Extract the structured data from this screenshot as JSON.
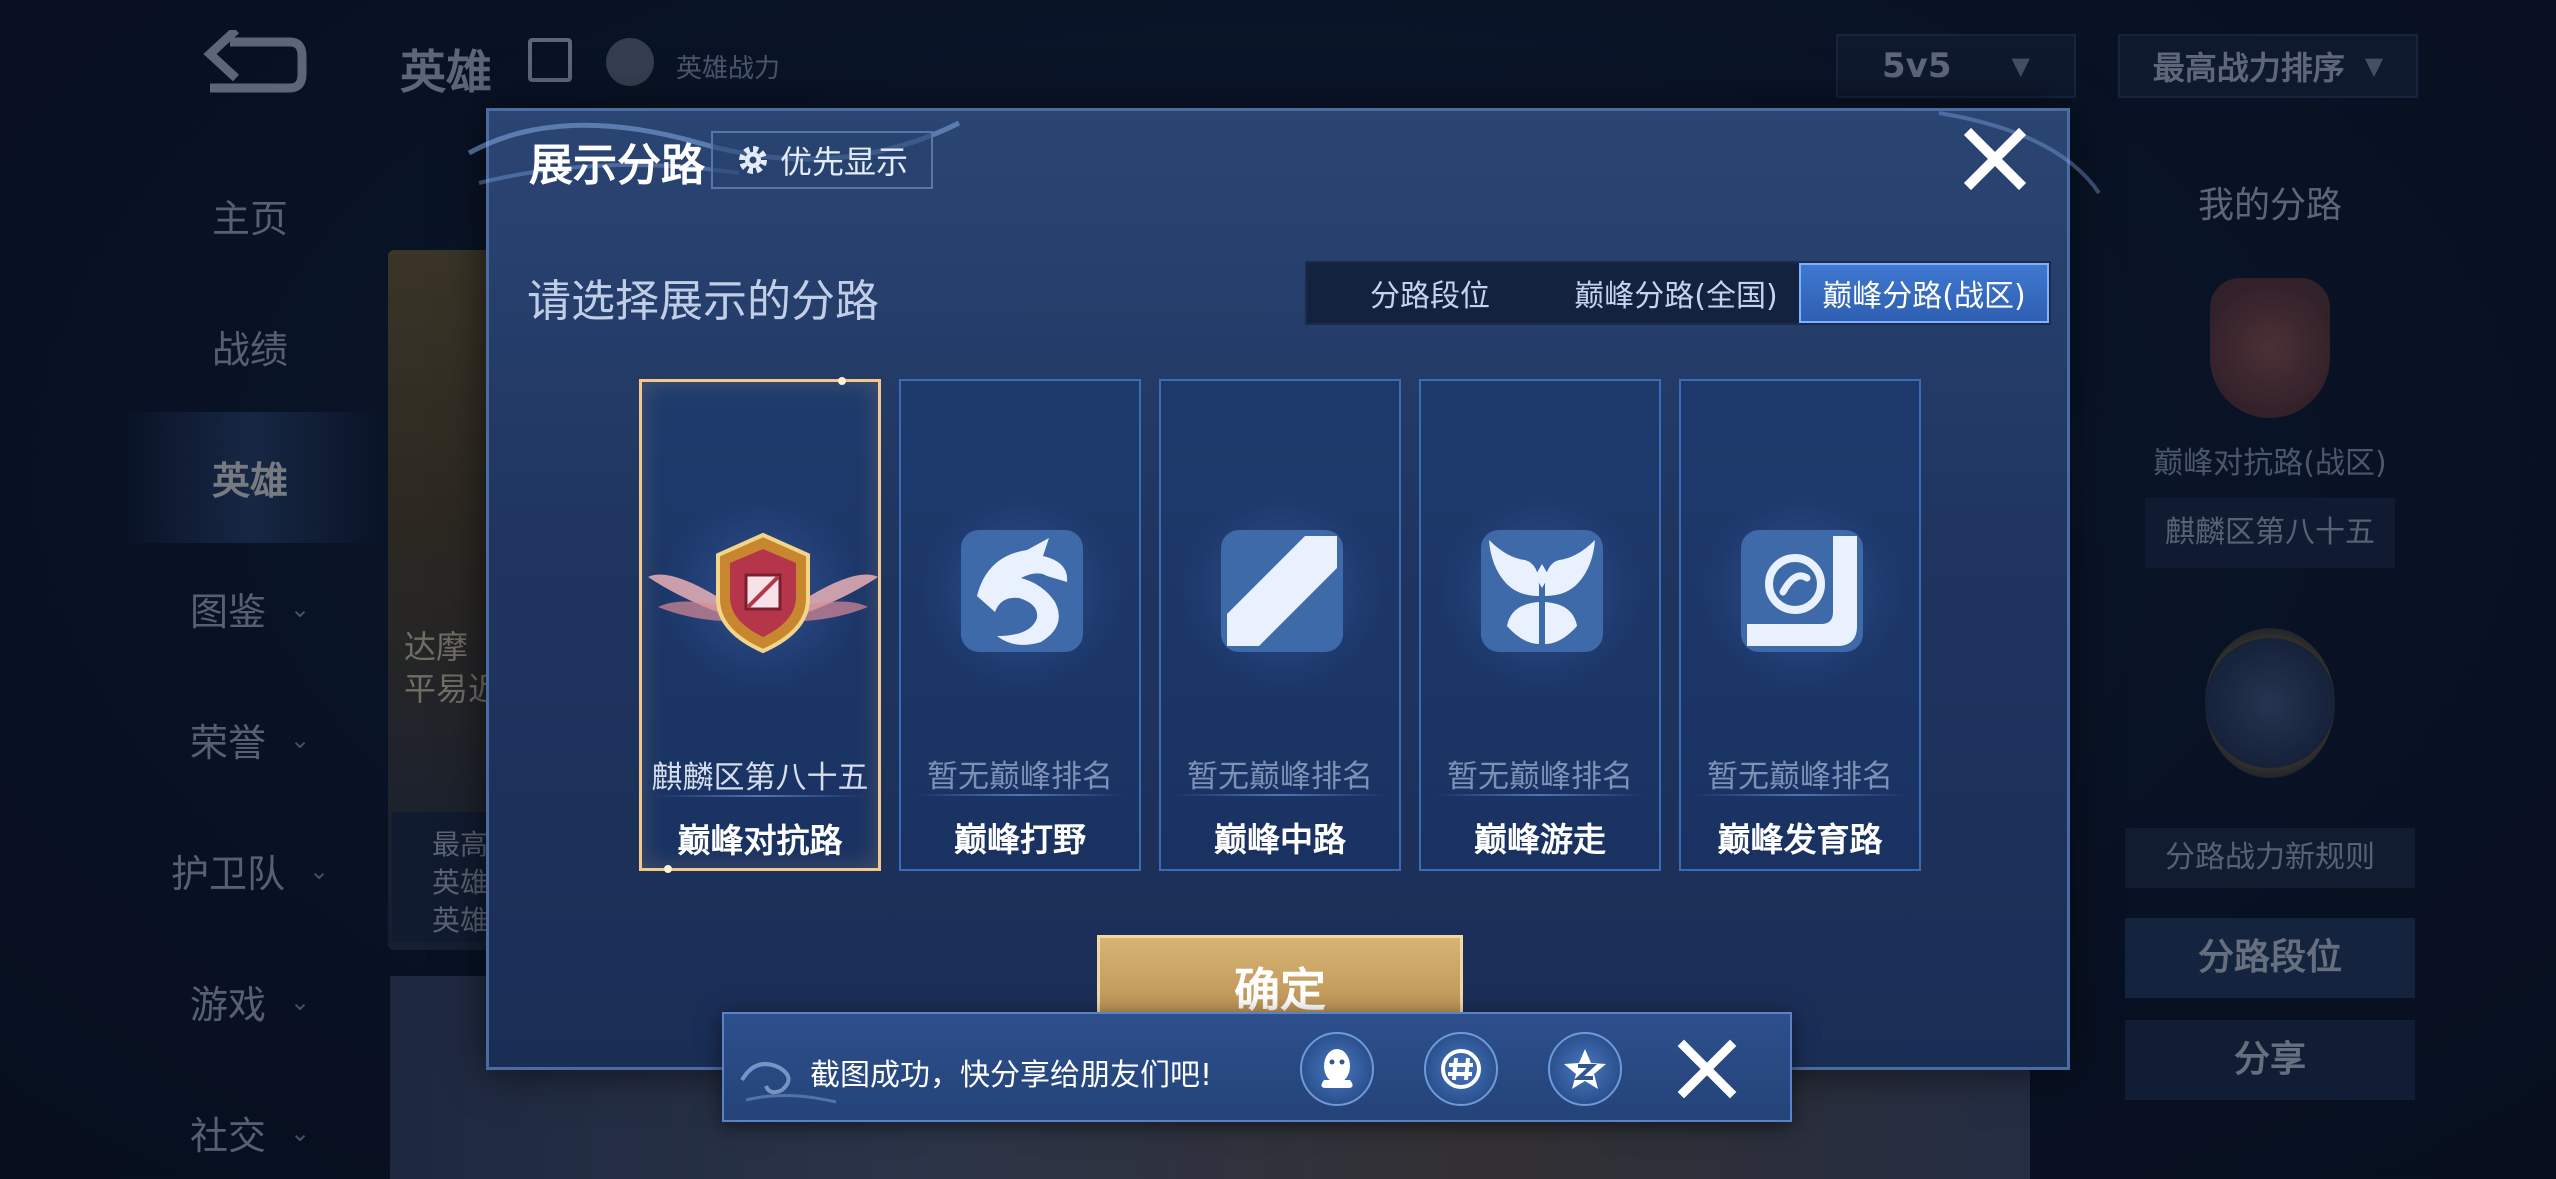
{
  "background": {
    "header": {
      "title": "英雄",
      "power_label": "英雄战力",
      "mode_select": "5v5",
      "sort_select": "最高战力排序"
    },
    "nav": [
      {
        "label": "主页",
        "has_chevron": false,
        "active": false
      },
      {
        "label": "战绩",
        "has_chevron": false,
        "active": false
      },
      {
        "label": "英雄",
        "has_chevron": false,
        "active": true
      },
      {
        "label": "图鉴",
        "has_chevron": true,
        "active": false
      },
      {
        "label": "荣誉",
        "has_chevron": true,
        "active": false
      },
      {
        "label": "护卫队",
        "has_chevron": true,
        "active": false
      },
      {
        "label": "游戏",
        "has_chevron": true,
        "active": false
      },
      {
        "label": "社交",
        "has_chevron": true,
        "active": false
      }
    ],
    "hero_card": {
      "name_line1": "达摩",
      "name_line2": "平易近",
      "info_line1": "最高",
      "info_line2": "英雄",
      "info_line3": "英雄"
    },
    "right_panel": {
      "title": "我的分路",
      "route": "巅峰对抗路(战区)",
      "rank": "麒麟区第八十五",
      "rule_button": "分路战力新规则",
      "route_rank_button": "分路段位",
      "share_button": "分享"
    }
  },
  "modal": {
    "title": "展示分路",
    "priority_button": "优先显示",
    "prompt": "请选择展示的分路",
    "tabs": [
      {
        "label": "分路段位",
        "active": false
      },
      {
        "label": "巅峰分路(全国)",
        "active": false
      },
      {
        "label": "巅峰分路(战区)",
        "active": true
      }
    ],
    "routes": [
      {
        "rank": "麒麟区第八十五",
        "name": "巅峰对抗路",
        "selected": true,
        "icon": "winged-shield-emblem-icon"
      },
      {
        "rank": "暂无巅峰排名",
        "name": "巅峰打野",
        "selected": false,
        "icon": "dragon-jungle-icon"
      },
      {
        "rank": "暂无巅峰排名",
        "name": "巅峰中路",
        "selected": false,
        "icon": "slash-mid-lane-icon"
      },
      {
        "rank": "暂无巅峰排名",
        "name": "巅峰游走",
        "selected": false,
        "icon": "wings-roam-icon"
      },
      {
        "rank": "暂无巅峰排名",
        "name": "巅峰发育路",
        "selected": false,
        "icon": "bottom-lane-icon"
      }
    ],
    "confirm_button": "确定"
  },
  "toast": {
    "message": "截图成功，快分享给朋友们吧!",
    "share_targets": [
      "qq-icon",
      "wechat-moments-icon",
      "qzone-icon"
    ]
  },
  "colors": {
    "accent_selected": "#f2c98a",
    "tab_active": "#3f78d0",
    "confirm": "#c9a262"
  }
}
